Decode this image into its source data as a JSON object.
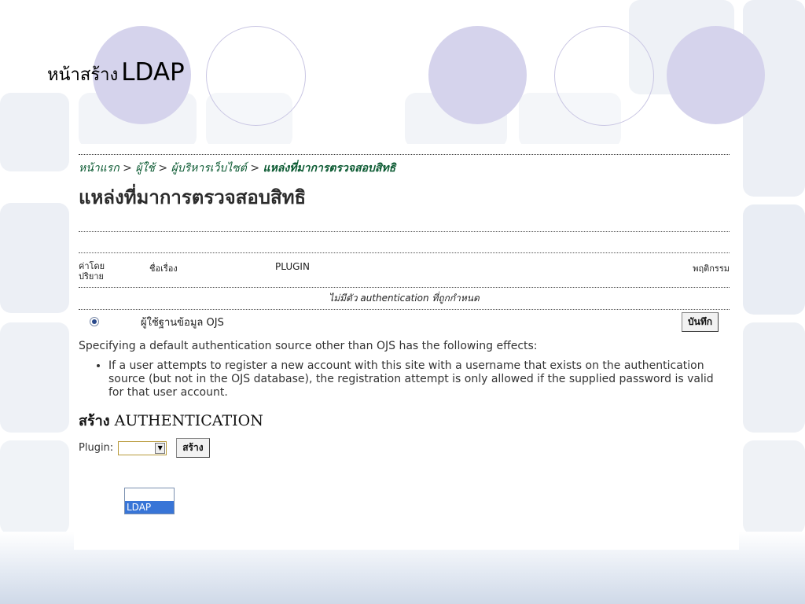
{
  "slide": {
    "title_thai": "หน้าสร้าง",
    "title_en": "LDAP"
  },
  "breadcrumb": {
    "home": "หน้าแรก",
    "users": "ผู้ใช้",
    "site_admin": "ผู้บริหารเว็บไซต์",
    "current": "แหล่งที่มาการตรวจสอบสิทธิ",
    "separator": ">"
  },
  "page_title": "แหล่งที่มาการตรวจสอบสิทธิ",
  "table": {
    "headers": {
      "default": "ค่าโดย\nปริยาย",
      "title": "ชื่อเรื่อง",
      "plugin": "PLUGIN",
      "action": "พฤติกรรม"
    },
    "empty_message": "ไม่มีตัว authentication ที่ถูกกำหนด",
    "rows": [
      {
        "selected": true,
        "name": "ผู้ใช้ฐานข้อมูล OJS",
        "button": "บันทึก"
      }
    ]
  },
  "description": "Specifying a default authentication source other than OJS has the following effects:",
  "bullets": [
    "If a user attempts to register a new account with this site with a username that exists on the authentication source (but not in the OJS database), the registration attempt is only allowed if the supplied password is valid for that user account."
  ],
  "create_section": {
    "title_thai": "สร้าง",
    "title_en": "AUTHENTICATION",
    "plugin_label": "Plugin:",
    "selected_value": "",
    "create_button": "สร้าง",
    "options": [
      "",
      "LDAP"
    ],
    "highlighted_option": "LDAP"
  },
  "colors": {
    "breadcrumb": "#0b5a32",
    "circle_fill": "#d5d3ec",
    "option_highlight": "#3875d7"
  }
}
